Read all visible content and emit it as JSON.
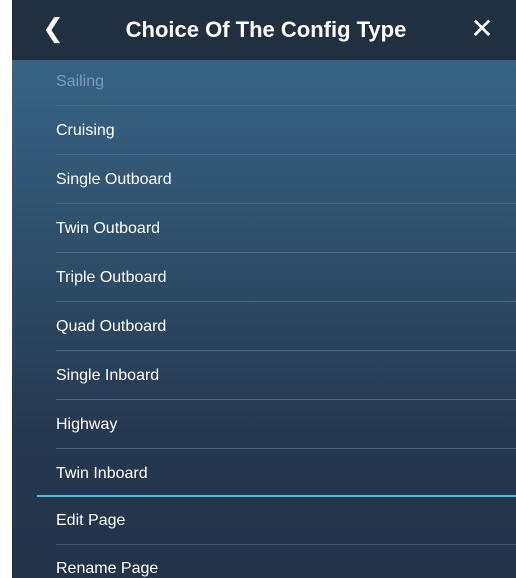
{
  "header": {
    "title": "Choice Of The Config Type",
    "back_icon": "chevron-left-icon",
    "close_icon": "close-icon"
  },
  "config_types": [
    {
      "label": "Sailing",
      "state": "disabled"
    },
    {
      "label": "Cruising"
    },
    {
      "label": "Single Outboard"
    },
    {
      "label": "Twin Outboard"
    },
    {
      "label": "Triple Outboard"
    },
    {
      "label": "Quad Outboard"
    },
    {
      "label": "Single Inboard"
    },
    {
      "label": "Highway"
    },
    {
      "label": "Twin Inboard"
    }
  ],
  "page_actions": [
    {
      "label": "Edit Page"
    },
    {
      "label": "Rename Page"
    }
  ],
  "colors": {
    "header_bg": "#203040",
    "accent_divider": "#52b9de",
    "disabled_text": "#7f9db5"
  }
}
